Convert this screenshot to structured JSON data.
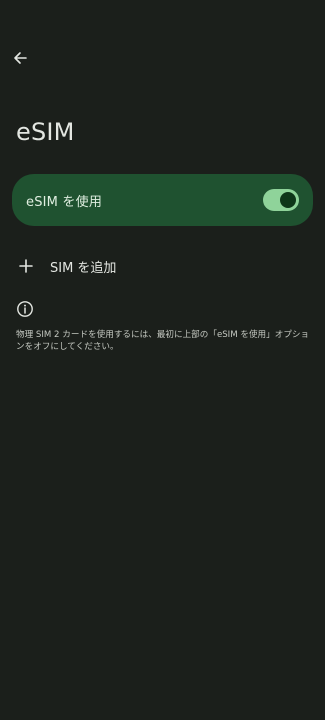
{
  "header": {
    "back_icon": "arrow-left-icon",
    "title": "eSIM"
  },
  "toggle": {
    "label": "eSIM を使用",
    "enabled": true,
    "colors": {
      "card": "#1f5230",
      "track": "#8fd39a",
      "thumb": "#0e3619"
    }
  },
  "add_sim": {
    "icon": "plus-icon",
    "label": "SIM を追加"
  },
  "info": {
    "icon": "info-icon",
    "text": "物理 SIM 2 カードを使用するには、最初に上部の「eSIM を使用」オプションをオフにしてください。"
  }
}
